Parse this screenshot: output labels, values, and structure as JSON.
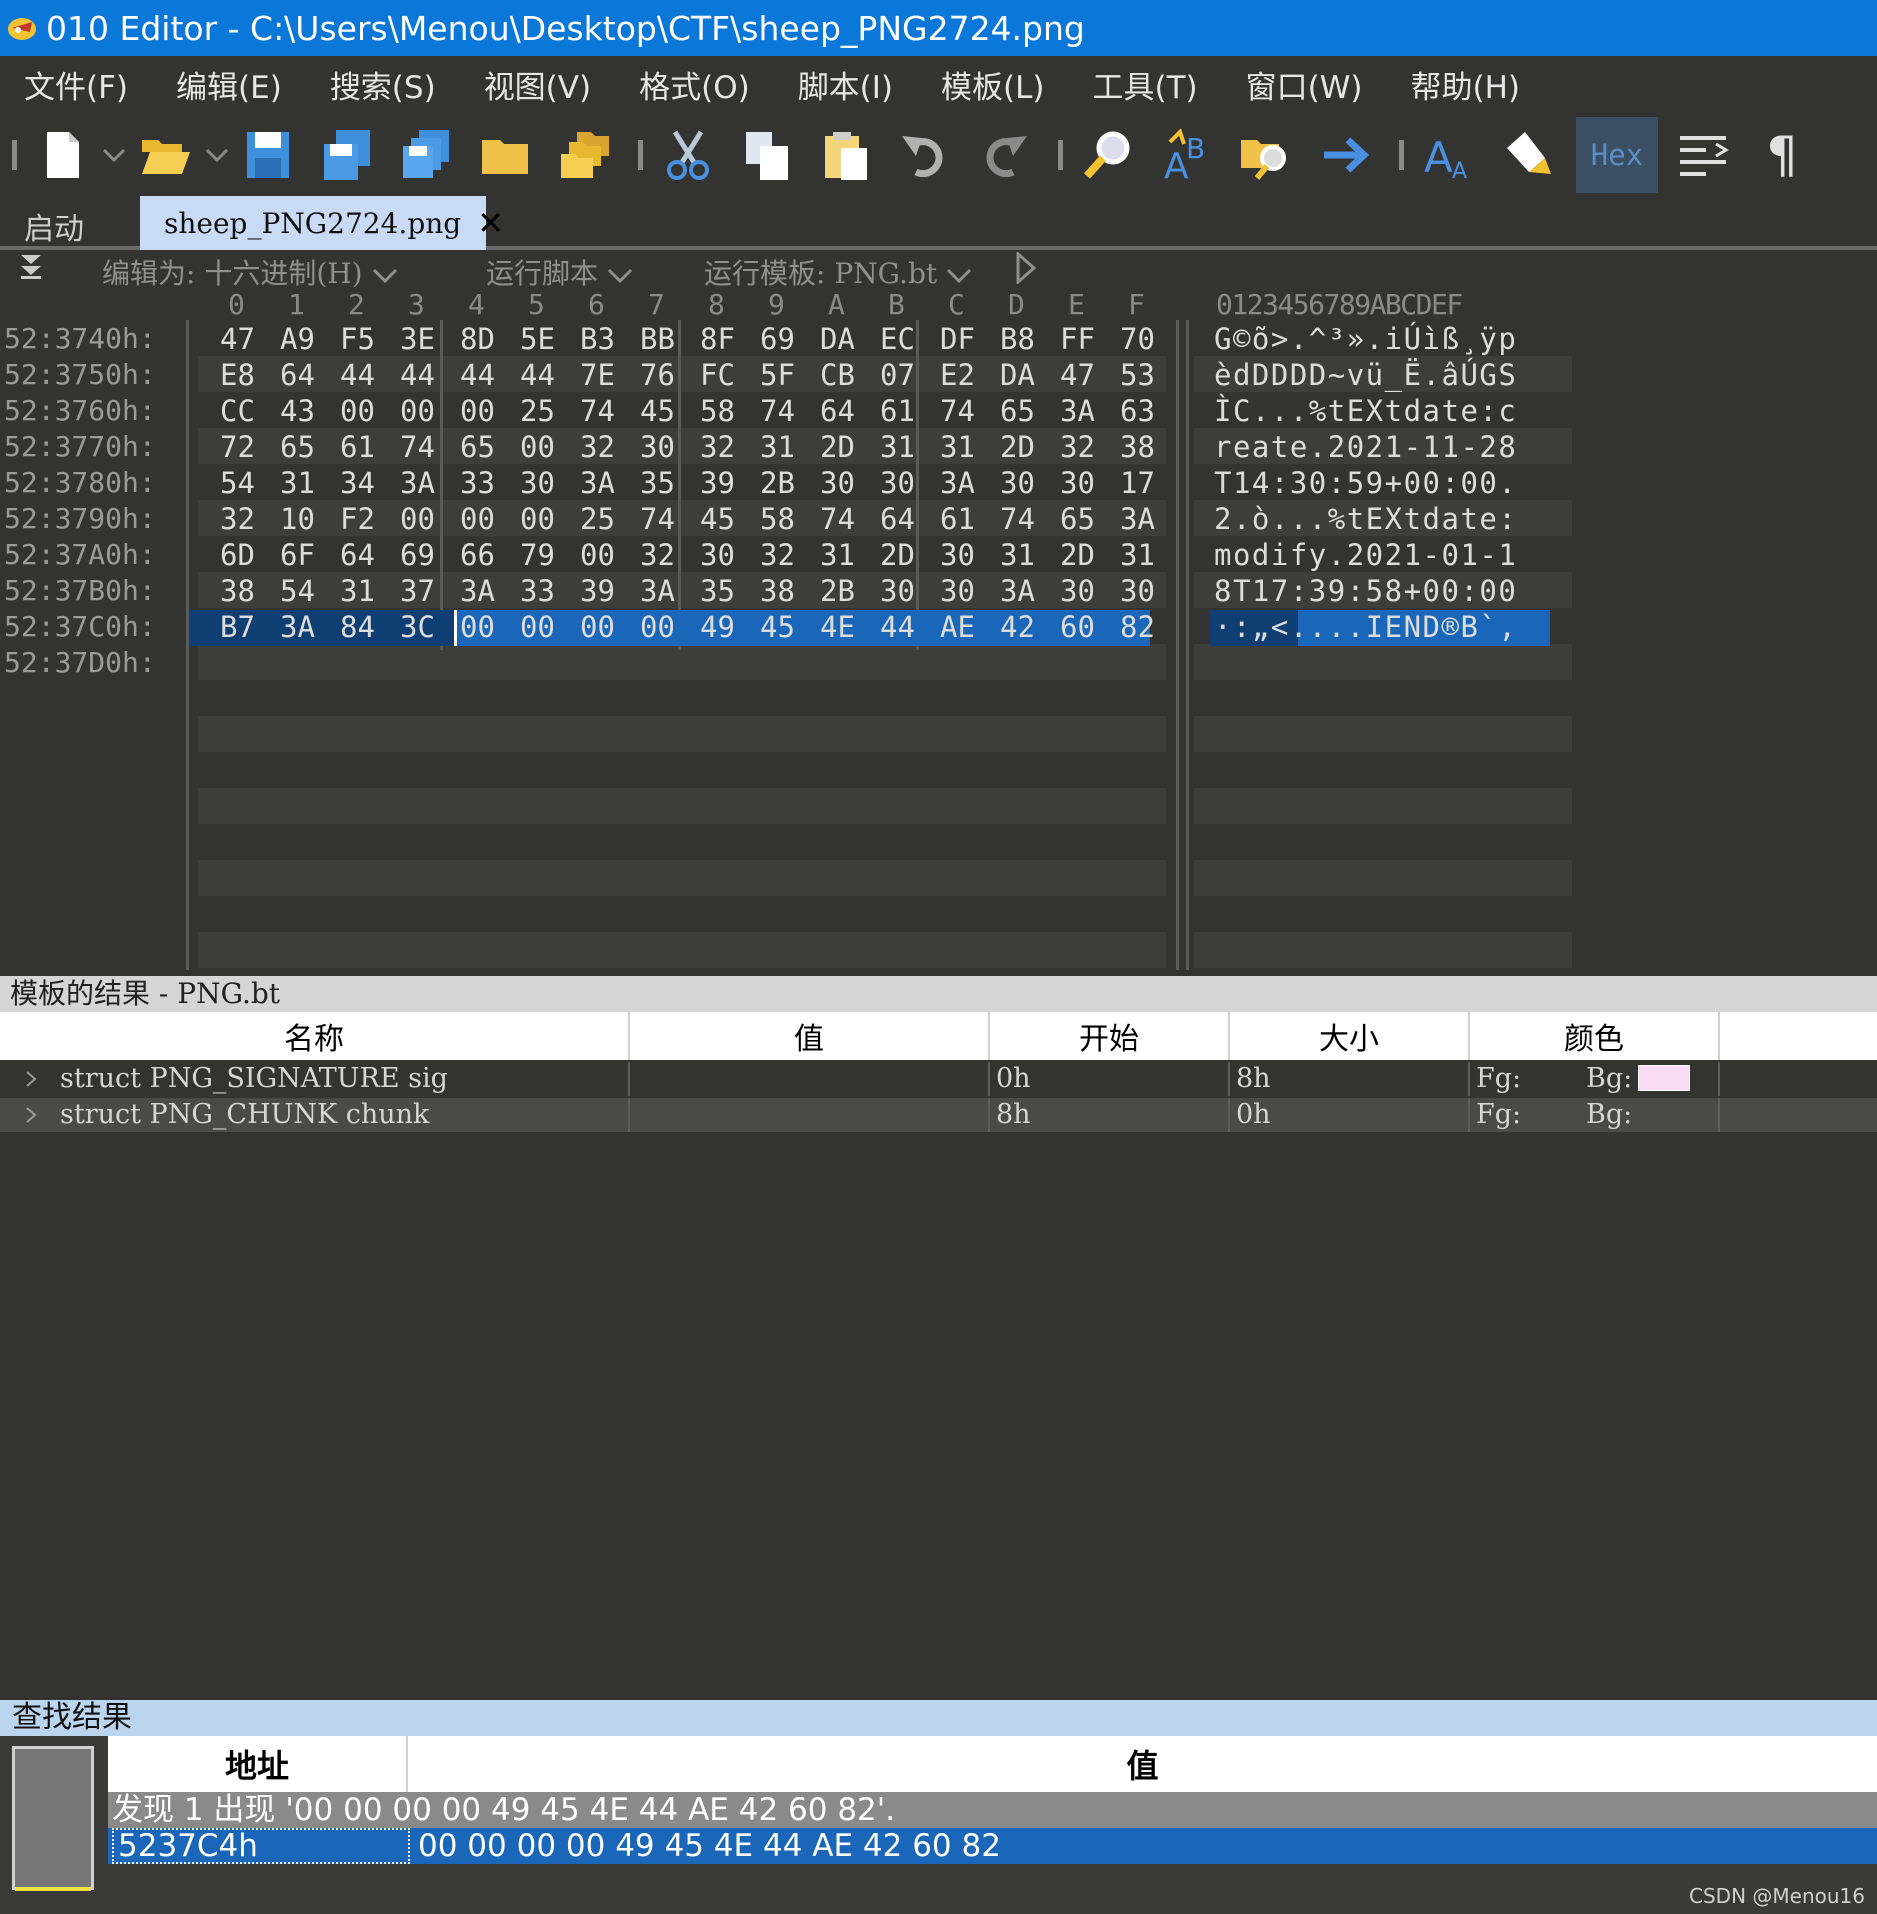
{
  "window": {
    "title": "010 Editor - C:\\Users\\Menou\\Desktop\\CTF\\sheep_PNG2724.png"
  },
  "menu": [
    "文件(F)",
    "编辑(E)",
    "搜索(S)",
    "视图(V)",
    "格式(O)",
    "脚本(I)",
    "模板(L)",
    "工具(T)",
    "窗口(W)",
    "帮助(H)"
  ],
  "toolbar": {
    "hex_label": "Hex",
    "paragraph": "¶"
  },
  "tabs": {
    "start": "启动",
    "file": "sheep_PNG2724.png",
    "close": "✕"
  },
  "options": {
    "edit_as": "编辑为: 十六进制(H)",
    "run_script": "运行脚本",
    "run_template": "运行模板: PNG.bt"
  },
  "hex": {
    "columns": [
      "0",
      "1",
      "2",
      "3",
      "4",
      "5",
      "6",
      "7",
      "8",
      "9",
      "A",
      "B",
      "C",
      "D",
      "E",
      "F"
    ],
    "ascii_header": "0123456789ABCDEF",
    "rows": [
      {
        "addr": "52:3740h:",
        "bytes": [
          "47",
          "A9",
          "F5",
          "3E",
          "8D",
          "5E",
          "B3",
          "BB",
          "8F",
          "69",
          "DA",
          "EC",
          "DF",
          "B8",
          "FF",
          "70"
        ],
        "ascii": "G©õ>.^³».iÚìß¸ÿp"
      },
      {
        "addr": "52:3750h:",
        "bytes": [
          "E8",
          "64",
          "44",
          "44",
          "44",
          "44",
          "7E",
          "76",
          "FC",
          "5F",
          "CB",
          "07",
          "E2",
          "DA",
          "47",
          "53"
        ],
        "ascii": "èdDDDD~vü_Ë.âÚGS"
      },
      {
        "addr": "52:3760h:",
        "bytes": [
          "CC",
          "43",
          "00",
          "00",
          "00",
          "25",
          "74",
          "45",
          "58",
          "74",
          "64",
          "61",
          "74",
          "65",
          "3A",
          "63"
        ],
        "ascii": "ÌC...%tEXtdate:c"
      },
      {
        "addr": "52:3770h:",
        "bytes": [
          "72",
          "65",
          "61",
          "74",
          "65",
          "00",
          "32",
          "30",
          "32",
          "31",
          "2D",
          "31",
          "31",
          "2D",
          "32",
          "38"
        ],
        "ascii": "reate.2021-11-28"
      },
      {
        "addr": "52:3780h:",
        "bytes": [
          "54",
          "31",
          "34",
          "3A",
          "33",
          "30",
          "3A",
          "35",
          "39",
          "2B",
          "30",
          "30",
          "3A",
          "30",
          "30",
          "17"
        ],
        "ascii": "T14:30:59+00:00."
      },
      {
        "addr": "52:3790h:",
        "bytes": [
          "32",
          "10",
          "F2",
          "00",
          "00",
          "00",
          "25",
          "74",
          "45",
          "58",
          "74",
          "64",
          "61",
          "74",
          "65",
          "3A"
        ],
        "ascii": "2.ò...%tEXtdate:"
      },
      {
        "addr": "52:37A0h:",
        "bytes": [
          "6D",
          "6F",
          "64",
          "69",
          "66",
          "79",
          "00",
          "32",
          "30",
          "32",
          "31",
          "2D",
          "30",
          "31",
          "2D",
          "31"
        ],
        "ascii": "modify.2021-01-1"
      },
      {
        "addr": "52:37B0h:",
        "bytes": [
          "38",
          "54",
          "31",
          "37",
          "3A",
          "33",
          "39",
          "3A",
          "35",
          "38",
          "2B",
          "30",
          "30",
          "3A",
          "30",
          "30"
        ],
        "ascii": "8T17:39:58+00:00"
      },
      {
        "addr": "52:37C0h:",
        "bytes": [
          "B7",
          "3A",
          "84",
          "3C",
          "00",
          "00",
          "00",
          "00",
          "49",
          "45",
          "4E",
          "44",
          "AE",
          "42",
          "60",
          "82"
        ],
        "ascii": "·:„<....IEND®B`‚"
      },
      {
        "addr": "52:37D0h:",
        "bytes": [],
        "ascii": ""
      }
    ]
  },
  "template": {
    "title": "模板的结果 - PNG.bt",
    "headers": [
      "名称",
      "值",
      "开始",
      "大小",
      "颜色"
    ],
    "rows": [
      {
        "name": "struct PNG_SIGNATURE sig",
        "value": "",
        "start": "0h",
        "size": "8h",
        "fg": "Fg:",
        "bg": "Bg:",
        "bg_swatch": "#fadcf2"
      },
      {
        "name": "struct PNG_CHUNK chunk",
        "value": "",
        "start": "8h",
        "size": "0h",
        "fg": "Fg:",
        "bg": "Bg:",
        "bg_swatch": ""
      }
    ]
  },
  "find": {
    "title": "查找结果",
    "headers": [
      "地址",
      "值"
    ],
    "summary": "发现 1 出现 '00 00 00 00 49 45 4E 44 AE 42 60 82'.",
    "result": {
      "address": "5237C4h",
      "value": "00 00 00 00 49 45 4E 44 AE 42 60 82"
    }
  },
  "watermark": "CSDN @Menou16",
  "colors": {
    "titlebar": "#0b77d8",
    "selection": "#1a66b8",
    "background": "#333331",
    "tab_active": "#c9daf4"
  }
}
